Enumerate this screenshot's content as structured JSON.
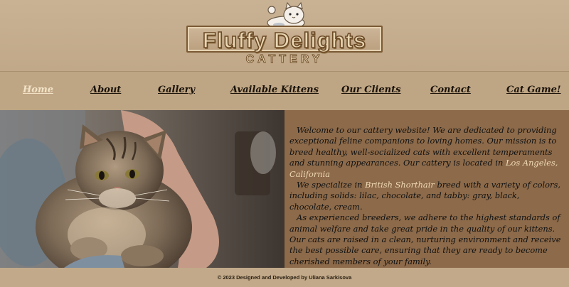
{
  "logo": {
    "title": "Fluffy Delights",
    "subtitle": "CATTERY",
    "icon": "cat-icon"
  },
  "nav": {
    "items": [
      {
        "label": "Home",
        "active": true
      },
      {
        "label": "About"
      },
      {
        "label": "Gallery"
      },
      {
        "label": "Available Kittens"
      },
      {
        "label": "Our Clients"
      },
      {
        "label": "Contact"
      },
      {
        "label": "Cat Game!"
      }
    ]
  },
  "hero": {
    "image": "british-shorthair-cat-photo",
    "p1_text": "Welcome to our cattery website! We are dedicated to providing exceptional feline companions to loving homes. Our mission is to breed healthy, well-socialized cats with excellent temperaments and stunning appearances. Our cattery is located in",
    "p1_location": "Los Angeles, California",
    "p2_pre": "We specialize in",
    "p2_breed": "British Shorthair",
    "p2_post": "breed with a variety of colors, including solids: lilac, chocolate, and tabby: gray, black, chocolate, cream.",
    "p3_text": "As experienced breeders, we adhere to the highest standards of animal welfare and take great pride in the quality of our kittens. Our cats are raised in a clean, nurturing environment and receive the best possible care, ensuring that they are ready to become cherished members of your family."
  },
  "footer": {
    "copyright": "© 2023 Designed and Developed by Uliana Sarkisova"
  },
  "colors": {
    "background": "#c2aa8c",
    "text_panel": "#8c6a4a",
    "highlight": "#f0d9b4"
  }
}
